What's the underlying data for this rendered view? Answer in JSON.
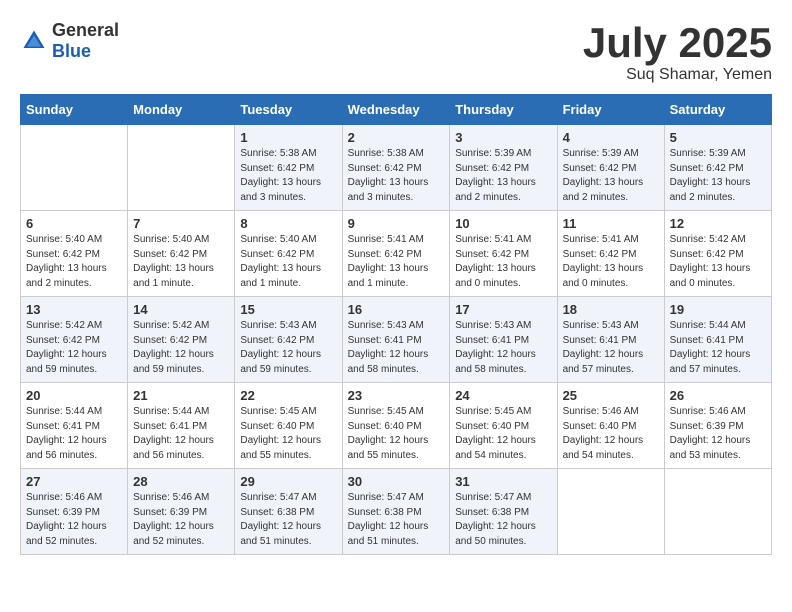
{
  "logo": {
    "general": "General",
    "blue": "Blue"
  },
  "header": {
    "month": "July 2025",
    "location": "Suq Shamar, Yemen"
  },
  "weekdays": [
    "Sunday",
    "Monday",
    "Tuesday",
    "Wednesday",
    "Thursday",
    "Friday",
    "Saturday"
  ],
  "weeks": [
    [
      {
        "day": null
      },
      {
        "day": null
      },
      {
        "day": "1",
        "sunrise": "5:38 AM",
        "sunset": "6:42 PM",
        "daylight": "13 hours and 3 minutes."
      },
      {
        "day": "2",
        "sunrise": "5:38 AM",
        "sunset": "6:42 PM",
        "daylight": "13 hours and 3 minutes."
      },
      {
        "day": "3",
        "sunrise": "5:39 AM",
        "sunset": "6:42 PM",
        "daylight": "13 hours and 2 minutes."
      },
      {
        "day": "4",
        "sunrise": "5:39 AM",
        "sunset": "6:42 PM",
        "daylight": "13 hours and 2 minutes."
      },
      {
        "day": "5",
        "sunrise": "5:39 AM",
        "sunset": "6:42 PM",
        "daylight": "13 hours and 2 minutes."
      }
    ],
    [
      {
        "day": "6",
        "sunrise": "5:40 AM",
        "sunset": "6:42 PM",
        "daylight": "13 hours and 2 minutes."
      },
      {
        "day": "7",
        "sunrise": "5:40 AM",
        "sunset": "6:42 PM",
        "daylight": "13 hours and 1 minute."
      },
      {
        "day": "8",
        "sunrise": "5:40 AM",
        "sunset": "6:42 PM",
        "daylight": "13 hours and 1 minute."
      },
      {
        "day": "9",
        "sunrise": "5:41 AM",
        "sunset": "6:42 PM",
        "daylight": "13 hours and 1 minute."
      },
      {
        "day": "10",
        "sunrise": "5:41 AM",
        "sunset": "6:42 PM",
        "daylight": "13 hours and 0 minutes."
      },
      {
        "day": "11",
        "sunrise": "5:41 AM",
        "sunset": "6:42 PM",
        "daylight": "13 hours and 0 minutes."
      },
      {
        "day": "12",
        "sunrise": "5:42 AM",
        "sunset": "6:42 PM",
        "daylight": "13 hours and 0 minutes."
      }
    ],
    [
      {
        "day": "13",
        "sunrise": "5:42 AM",
        "sunset": "6:42 PM",
        "daylight": "12 hours and 59 minutes."
      },
      {
        "day": "14",
        "sunrise": "5:42 AM",
        "sunset": "6:42 PM",
        "daylight": "12 hours and 59 minutes."
      },
      {
        "day": "15",
        "sunrise": "5:43 AM",
        "sunset": "6:42 PM",
        "daylight": "12 hours and 59 minutes."
      },
      {
        "day": "16",
        "sunrise": "5:43 AM",
        "sunset": "6:41 PM",
        "daylight": "12 hours and 58 minutes."
      },
      {
        "day": "17",
        "sunrise": "5:43 AM",
        "sunset": "6:41 PM",
        "daylight": "12 hours and 58 minutes."
      },
      {
        "day": "18",
        "sunrise": "5:43 AM",
        "sunset": "6:41 PM",
        "daylight": "12 hours and 57 minutes."
      },
      {
        "day": "19",
        "sunrise": "5:44 AM",
        "sunset": "6:41 PM",
        "daylight": "12 hours and 57 minutes."
      }
    ],
    [
      {
        "day": "20",
        "sunrise": "5:44 AM",
        "sunset": "6:41 PM",
        "daylight": "12 hours and 56 minutes."
      },
      {
        "day": "21",
        "sunrise": "5:44 AM",
        "sunset": "6:41 PM",
        "daylight": "12 hours and 56 minutes."
      },
      {
        "day": "22",
        "sunrise": "5:45 AM",
        "sunset": "6:40 PM",
        "daylight": "12 hours and 55 minutes."
      },
      {
        "day": "23",
        "sunrise": "5:45 AM",
        "sunset": "6:40 PM",
        "daylight": "12 hours and 55 minutes."
      },
      {
        "day": "24",
        "sunrise": "5:45 AM",
        "sunset": "6:40 PM",
        "daylight": "12 hours and 54 minutes."
      },
      {
        "day": "25",
        "sunrise": "5:46 AM",
        "sunset": "6:40 PM",
        "daylight": "12 hours and 54 minutes."
      },
      {
        "day": "26",
        "sunrise": "5:46 AM",
        "sunset": "6:39 PM",
        "daylight": "12 hours and 53 minutes."
      }
    ],
    [
      {
        "day": "27",
        "sunrise": "5:46 AM",
        "sunset": "6:39 PM",
        "daylight": "12 hours and 52 minutes."
      },
      {
        "day": "28",
        "sunrise": "5:46 AM",
        "sunset": "6:39 PM",
        "daylight": "12 hours and 52 minutes."
      },
      {
        "day": "29",
        "sunrise": "5:47 AM",
        "sunset": "6:38 PM",
        "daylight": "12 hours and 51 minutes."
      },
      {
        "day": "30",
        "sunrise": "5:47 AM",
        "sunset": "6:38 PM",
        "daylight": "12 hours and 51 minutes."
      },
      {
        "day": "31",
        "sunrise": "5:47 AM",
        "sunset": "6:38 PM",
        "daylight": "12 hours and 50 minutes."
      },
      {
        "day": null
      },
      {
        "day": null
      }
    ]
  ]
}
